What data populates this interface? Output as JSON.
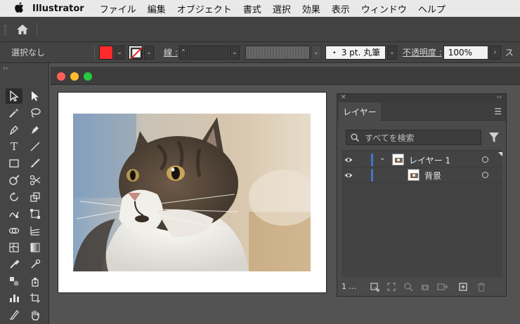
{
  "menubar": {
    "app": "Illustrator",
    "items": [
      "ファイル",
      "編集",
      "オブジェクト",
      "書式",
      "選択",
      "効果",
      "表示",
      "ウィンドウ",
      "ヘルプ"
    ]
  },
  "control": {
    "selection": "選択なし",
    "fill_color": "#ff2a2a",
    "stroke_label": "線 :",
    "brush": "・ 3 pt. 丸筆",
    "opacity_label": "不透明度 :",
    "opacity_value": "100%",
    "more": "ス"
  },
  "window_lights": [
    "#ff5f57",
    "#febc2e",
    "#28c840"
  ],
  "layers_panel": {
    "tab": "レイヤー",
    "search_placeholder": "すべてを検索",
    "rows": [
      {
        "name": "レイヤー 1",
        "expanded": true
      },
      {
        "name": "背景"
      }
    ],
    "footer_count": "1 ..."
  },
  "accent": "#4a72c4"
}
